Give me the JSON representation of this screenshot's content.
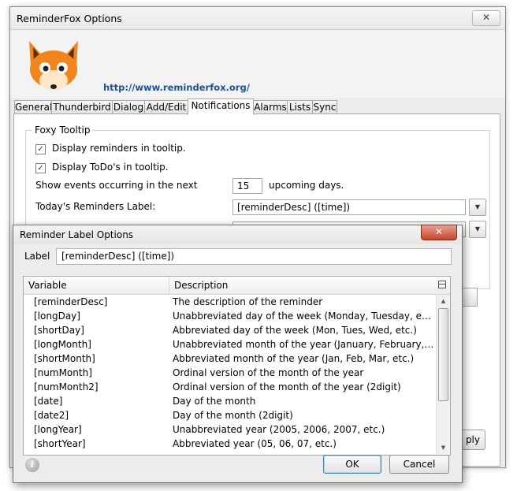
{
  "main_window": {
    "title": "ReminderFox Options",
    "close_glyph": "✕",
    "link": "http://www.reminderfox.org/",
    "tabs": [
      "General",
      "Thunderbird",
      "Dialog",
      "Add/Edit",
      "Notifications",
      "Alarms",
      "Lists",
      "Sync"
    ],
    "active_tab": "Notifications",
    "foxy_tooltip": {
      "legend": "Foxy Tooltip",
      "display_reminders": "Display reminders in tooltip.",
      "display_todos": "Display ToDo's in tooltip.",
      "show_events_label": "Show events occurring in the next",
      "days_value": "15",
      "days_suffix": "upcoming days.",
      "todays_label": "Today's Reminders Label:",
      "todays_value": "[reminderDesc] ([time])"
    },
    "apply_label": "ply"
  },
  "dialog": {
    "title": "Reminder Label Options",
    "close_glyph": "✕",
    "label_caption": "Label",
    "label_value": "[reminderDesc] ([time])",
    "columns": {
      "variable": "Variable",
      "description": "Description"
    },
    "rows": [
      {
        "variable": "[reminderDesc]",
        "description": "The description of the reminder"
      },
      {
        "variable": "[longDay]",
        "description": "Unabbreviated day of the week (Monday, Tuesday, etc.)"
      },
      {
        "variable": "[shortDay]",
        "description": "Abbreviated day of the week (Mon, Tues, Wed, etc.)"
      },
      {
        "variable": "[longMonth]",
        "description": "Unabbreviated month of the year (January, February, March, ..."
      },
      {
        "variable": "[shortMonth]",
        "description": "Abbreviated month of the year (Jan, Feb, Mar, etc.)"
      },
      {
        "variable": "[numMonth]",
        "description": "Ordinal version of the month of the year"
      },
      {
        "variable": "[numMonth2]",
        "description": "Ordinal version of the month of the year  (2digit)"
      },
      {
        "variable": "[date]",
        "description": "Day of the month"
      },
      {
        "variable": "[date2]",
        "description": "Day of the month  (2digit)"
      },
      {
        "variable": "[longYear]",
        "description": "Unabbreviated year (2005, 2006, 2007, etc.)"
      },
      {
        "variable": "[shortYear]",
        "description": "Abbreviated year (05, 06, 07, etc.)"
      }
    ],
    "info_glyph": "i",
    "ok_label": "OK",
    "cancel_label": "Cancel"
  },
  "colors": {
    "link": "#1d4f9c",
    "close_red": "#c7442b",
    "fox_orange": "#f0851e"
  },
  "icons": [
    "fox-logo",
    "checkbox-checked-icon",
    "dropdown-arrow-icon",
    "close-icon",
    "column-picker-icon",
    "scroll-up-icon",
    "scroll-down-icon",
    "info-icon"
  ]
}
